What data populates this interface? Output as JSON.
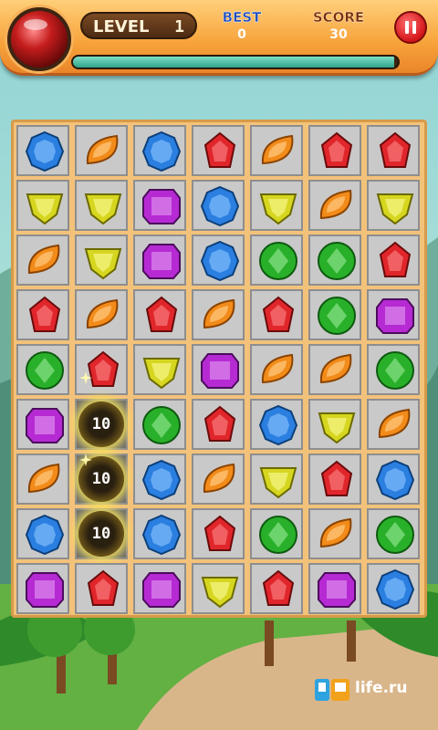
{
  "hud": {
    "level_label": "LEVEL",
    "level_value": "1",
    "best_label": "BEST",
    "best_value": "0",
    "score_label": "SCORE",
    "score_value": "30",
    "progress_fraction": 0.99,
    "pause_icon": "pause-icon"
  },
  "board": {
    "rows": [
      [
        "blue",
        "orange",
        "blue",
        "red",
        "orange",
        "red",
        "red"
      ],
      [
        "yellow",
        "yellow",
        "purple",
        "blue",
        "yellow",
        "orange",
        "yellow"
      ],
      [
        "orange",
        "yellow",
        "purple",
        "blue",
        "green",
        "green",
        "red"
      ],
      [
        "red",
        "orange",
        "red",
        "orange",
        "red",
        "green",
        "purple"
      ],
      [
        "green",
        "red",
        "yellow",
        "purple",
        "orange",
        "orange",
        "green"
      ],
      [
        "purple",
        "badge",
        "green",
        "red",
        "blue",
        "yellow",
        "orange"
      ],
      [
        "orange",
        "badge",
        "blue",
        "orange",
        "yellow",
        "red",
        "blue"
      ],
      [
        "blue",
        "badge",
        "blue",
        "red",
        "green",
        "orange",
        "green"
      ],
      [
        "purple",
        "red",
        "purple",
        "yellow",
        "red",
        "purple",
        "blue"
      ]
    ],
    "badges": [
      "10",
      "10",
      "10"
    ]
  },
  "colors": {
    "red": "#e0262b",
    "orange": "#f28b19",
    "blue": "#2a7fe0",
    "yellow": "#d6d620",
    "green": "#29b02a",
    "purple": "#b62ad3"
  },
  "watermark": {
    "logo_icon": "pda-logo-icon",
    "text": "life.ru"
  }
}
